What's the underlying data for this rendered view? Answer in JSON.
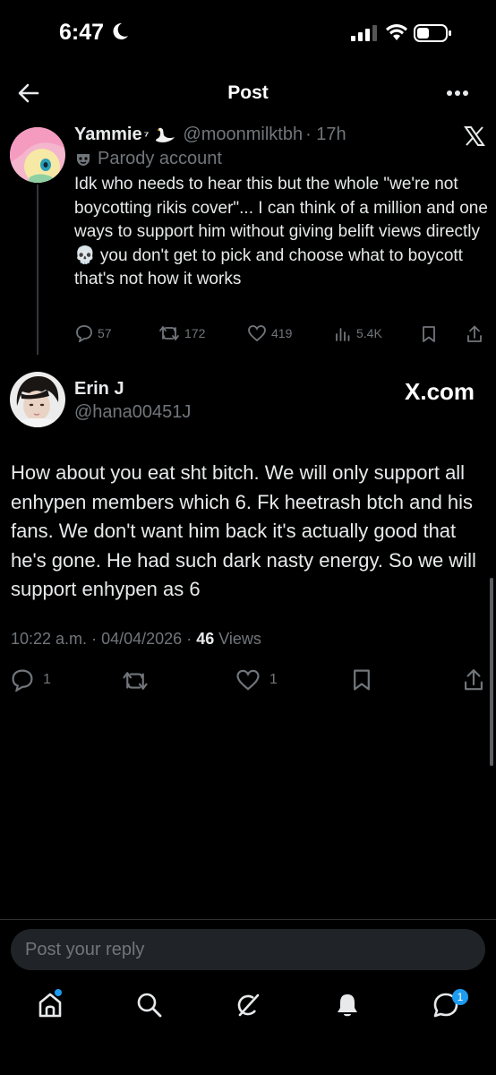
{
  "status_bar": {
    "time": "6:47"
  },
  "header": {
    "title": "Post"
  },
  "quoted_post": {
    "display_name": "Yammie",
    "name_suffix": "⁷",
    "handle": "@moonmilktbh",
    "time_ago": "· 17h",
    "label": "Parody account",
    "text": "Idk who needs to hear this but the whole \"we're not boycotting rikis cover\"... I can think of a million and one ways to support him without giving belift views directly 💀 you don't get to pick and choose what to boycott that's not how it works",
    "replies": "57",
    "reposts": "172",
    "likes": "419",
    "views": "5.4K"
  },
  "main_post": {
    "display_name": "Erin J",
    "handle": "@hana00451J",
    "watermark": "X.com",
    "text": "How about you eat sht bitch. We will only support all enhypen members which 6. Fk heetrash btch and his fans. We don't want him back it's actually good that he's gone. He had such dark nasty energy. So we will support enhypen as 6",
    "time": "10:22 a.m.",
    "date": "04/04/2026",
    "views_count": "46",
    "views_label": "Views",
    "replies": "1",
    "likes": "1"
  },
  "reply_bar": {
    "placeholder": "Post your reply"
  },
  "nav": {
    "messages_badge": "1"
  },
  "colors": {
    "background": "#000000",
    "text": "#e7e9ea",
    "muted": "#71767b",
    "accent": "#1d9bf0"
  },
  "icons": [
    "back-arrow-icon",
    "more-icon",
    "x-logo-icon",
    "parody-mask-icon",
    "reply-icon",
    "repost-icon",
    "like-icon",
    "views-icon",
    "bookmark-icon",
    "share-icon",
    "home-icon",
    "search-icon",
    "grok-icon",
    "notifications-icon",
    "messages-icon"
  ]
}
